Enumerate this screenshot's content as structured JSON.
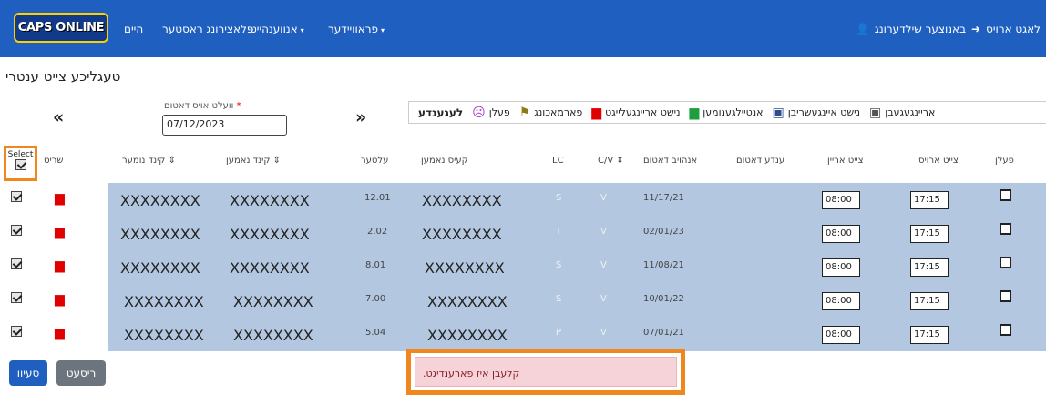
{
  "nav": {
    "logo_text": "CAPS ONLINE",
    "links": [
      "היים",
      "פלאצירונג ראסטער",
      "אנווענהייט",
      "פראוויידער"
    ],
    "user_name": "באנוצער שילדערונג",
    "logout": "לאגט ארויס"
  },
  "page": {
    "title": "טעגליכע צייט ענטרי",
    "prev_arrow": "«",
    "next_arrow": "»",
    "date_label": "וועלט אויס דאטום",
    "date_required": "*",
    "date_value": "07/12/2023"
  },
  "legend": {
    "title": "לעגענדע",
    "items": [
      {
        "label": "פעלן",
        "icon": "absent-face-icon",
        "color": "#a23cc8"
      },
      {
        "label": "פארמאכונג",
        "icon": "flag-icon",
        "color": "#8a7a1a"
      },
      {
        "label": "נישט אריינגעלייגט",
        "icon": "calendar-red-icon",
        "color": "#e00000"
      },
      {
        "label": "אנטיילגענומען",
        "icon": "calendar-green-icon",
        "color": "#1e9e3e"
      },
      {
        "label": "נישט איינגעשריבן",
        "icon": "calendar-x-icon",
        "color": "#2e4c8a"
      },
      {
        "label": "אריינגעגעבן",
        "icon": "calendar-check-icon",
        "color": "#555555"
      }
    ]
  },
  "table": {
    "headers": {
      "select": "Select",
      "remove": "שריט",
      "child_number": "קינד נומער",
      "child_name": "קינד נאמען",
      "age": "עלטער",
      "provider_name": "קעיס נאמען",
      "lc": "LC",
      "cv": "C/V",
      "start_date": "אנהויב דאטום",
      "end_date": "ענדע דאטום",
      "time_in": "צייט אריין",
      "time_out": "צייט ארויס",
      "absent": "פעלן"
    },
    "rows": [
      {
        "number": "XXXXXXXX",
        "name": "XXXXXXXX",
        "age": "12.01",
        "provider": "XXXXXXXX",
        "lc": "S",
        "cv": "V",
        "start": "11/17/21",
        "end": "",
        "time_in": "08:00",
        "time_out": "17:15"
      },
      {
        "number": "XXXXXXXX",
        "name": "XXXXXXXX",
        "age": "2.02",
        "provider": "XXXXXXXX",
        "lc": "T",
        "cv": "V",
        "start": "02/01/23",
        "end": "",
        "time_in": "08:00",
        "time_out": "17:15"
      },
      {
        "number": "XXXXXXXX",
        "name": "XXXXXXXX",
        "age": "8.01",
        "provider": "XXXXXXXX",
        "lc": "S",
        "cv": "V",
        "start": "11/08/21",
        "end": "",
        "time_in": "08:00",
        "time_out": "17:15"
      },
      {
        "number": "XXXXXXXX",
        "name": "XXXXXXXX",
        "age": "7.00",
        "provider": "XXXXXXXX",
        "lc": "S",
        "cv": "V",
        "start": "10/01/22",
        "end": "",
        "time_in": "08:00",
        "time_out": "17:15"
      },
      {
        "number": "XXXXXXXX",
        "name": "XXXXXXXX",
        "age": "5.04",
        "provider": "XXXXXXXX",
        "lc": "P",
        "cv": "V",
        "start": "07/01/21",
        "end": "",
        "time_in": "08:00",
        "time_out": "17:15"
      }
    ]
  },
  "actions": {
    "save": "סעיוו",
    "reset": "ריסעט"
  },
  "alert": {
    "text": ".קלעבן איז פארענדיגט"
  }
}
